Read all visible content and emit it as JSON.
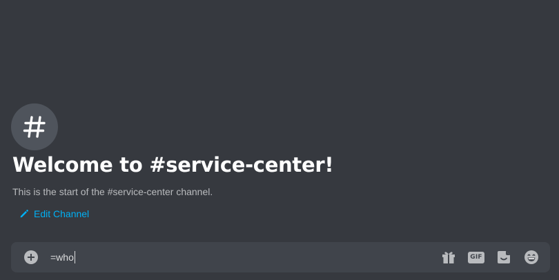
{
  "channel": {
    "welcome_title": "Welcome to #service-center!",
    "description": "This is the start of the #service-center channel.",
    "edit_label": "Edit Channel",
    "icon": "hashtag-icon"
  },
  "composer": {
    "input_value": "=who",
    "buttons": [
      {
        "icon": "gift-icon"
      },
      {
        "icon": "gif-icon",
        "label": "GIF"
      },
      {
        "icon": "sticker-icon"
      },
      {
        "icon": "emoji-icon"
      }
    ]
  },
  "colors": {
    "background": "#36393f",
    "composer": "#40444b",
    "link": "#00b0f4",
    "avatar": "#4f545c",
    "muted_text": "#b9bbbe"
  }
}
